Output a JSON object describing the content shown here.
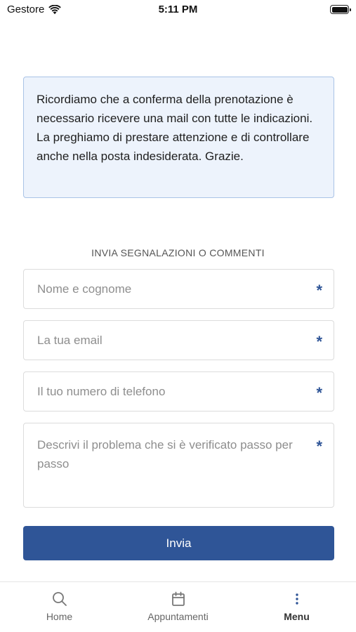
{
  "status_bar": {
    "carrier": "Gestore",
    "time": "5:11 PM"
  },
  "notice": {
    "text": "Ricordiamo che a conferma della prenotazione è necessario ricevere una mail con tutte le indicazioni. La preghiamo di prestare attenzione e di controllare anche nella posta indesiderata. Grazie."
  },
  "form": {
    "section_title": "INVIA SEGNALAZIONI O COMMENTI",
    "required_mark": "*",
    "name_placeholder": "Nome e cognome",
    "email_placeholder": "La tua email",
    "phone_placeholder": "Il tuo numero di telefono",
    "description_placeholder": "Descrivi il problema che si è verificato passo per passo",
    "submit_label": "Invia"
  },
  "tabbar": {
    "items": [
      {
        "label": "Home",
        "icon": "search-icon"
      },
      {
        "label": "Appuntamenti",
        "icon": "calendar-icon"
      },
      {
        "label": "Menu",
        "icon": "more-vertical-icon",
        "active": true
      }
    ]
  },
  "colors": {
    "accent": "#2f5597",
    "notice_background": "#edf3fc",
    "notice_border": "#a9c3e6"
  }
}
